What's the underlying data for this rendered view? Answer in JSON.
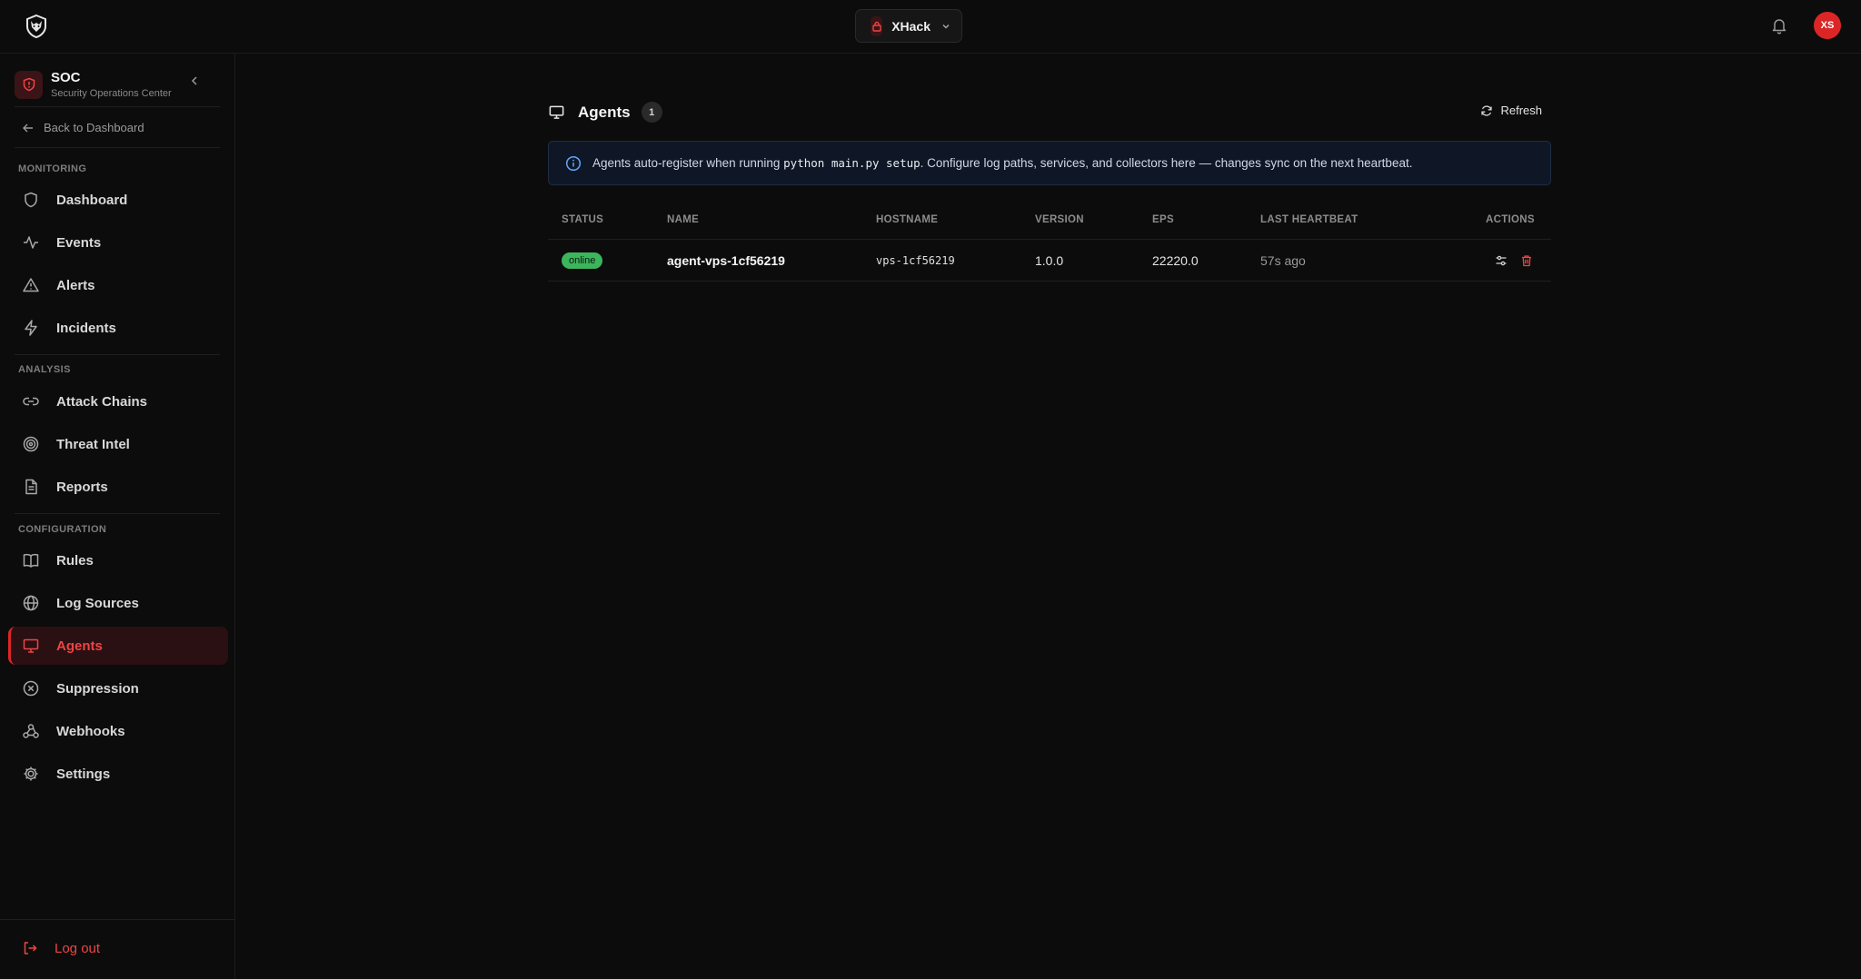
{
  "topbar": {
    "workspace": "XHack",
    "avatar_initials": "XS"
  },
  "sidebar": {
    "app_title": "SOC",
    "app_subtitle": "Security Operations Center",
    "back_label": "Back to Dashboard",
    "sections": [
      {
        "label": "MONITORING",
        "items": [
          {
            "label": "Dashboard",
            "icon": "shield-icon"
          },
          {
            "label": "Events",
            "icon": "activity-icon"
          },
          {
            "label": "Alerts",
            "icon": "warning-triangle-icon"
          },
          {
            "label": "Incidents",
            "icon": "lightning-icon"
          }
        ]
      },
      {
        "label": "ANALYSIS",
        "items": [
          {
            "label": "Attack Chains",
            "icon": "link-icon"
          },
          {
            "label": "Threat Intel",
            "icon": "target-icon"
          },
          {
            "label": "Reports",
            "icon": "document-icon"
          }
        ]
      },
      {
        "label": "CONFIGURATION",
        "items": [
          {
            "label": "Rules",
            "icon": "book-icon"
          },
          {
            "label": "Log Sources",
            "icon": "globe-icon"
          },
          {
            "label": "Agents",
            "icon": "monitor-icon",
            "active": true
          },
          {
            "label": "Suppression",
            "icon": "circle-x-icon"
          },
          {
            "label": "Webhooks",
            "icon": "webhook-icon"
          },
          {
            "label": "Settings",
            "icon": "gear-icon"
          }
        ]
      }
    ],
    "logout_label": "Log out"
  },
  "main": {
    "title": "Agents",
    "count": "1",
    "refresh_label": "Refresh",
    "banner": {
      "prefix": "Agents auto-register when running ",
      "code": "python main.py setup",
      "suffix": ". Configure log paths, services, and collectors here — changes sync on the next heartbeat."
    },
    "table": {
      "headers": [
        "STATUS",
        "NAME",
        "HOSTNAME",
        "VERSION",
        "EPS",
        "LAST HEARTBEAT",
        "ACTIONS"
      ],
      "rows": [
        {
          "status": "online",
          "name": "agent-vps-1cf56219",
          "hostname": "vps-1cf56219",
          "version": "1.0.0",
          "eps": "22220.0",
          "heartbeat": "57s ago"
        }
      ]
    }
  },
  "colors": {
    "accent": "#dc2626",
    "online": "#3cb55c",
    "banner_bg": "#0f1726"
  }
}
